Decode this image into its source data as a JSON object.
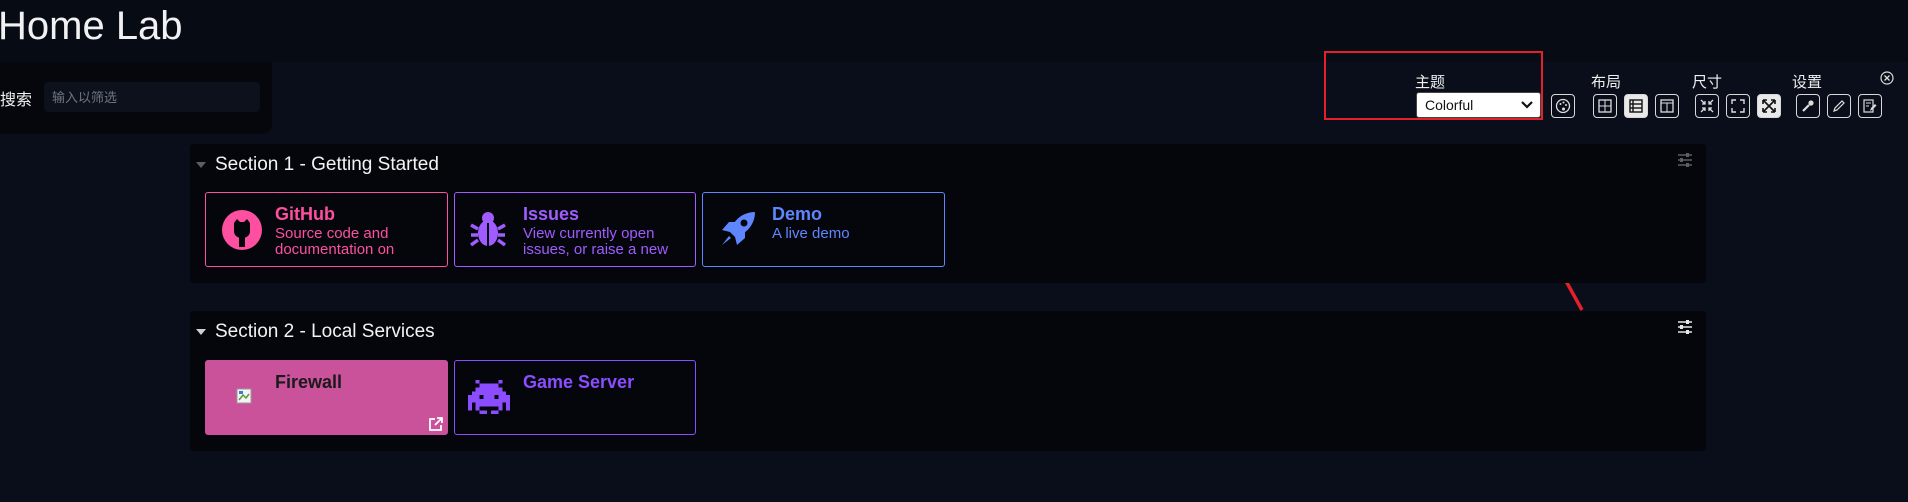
{
  "app": {
    "title": "Home Lab"
  },
  "search": {
    "label": "搜索",
    "placeholder": "输入以筛选"
  },
  "settings": {
    "theme_label": "主题",
    "theme_value": "Colorful",
    "layout_label": "布局",
    "size_label": "尺寸",
    "config_label": "设置"
  },
  "sections": [
    {
      "title": "Section 1 - Getting Started",
      "items": [
        {
          "title": "GitHub",
          "description": "Source code and documentation on",
          "color": "#ff4fa0",
          "icon": "github-icon"
        },
        {
          "title": "Issues",
          "description": "View currently open issues, or raise a new",
          "color": "#a05cff",
          "icon": "bug-icon"
        },
        {
          "title": "Demo",
          "description": "A live demo",
          "color": "#5f86ff",
          "icon": "rocket-icon"
        }
      ]
    },
    {
      "title": "Section 2 - Local Services",
      "items": [
        {
          "title": "Firewall",
          "color": "#c9529a",
          "icon": "broken-image-icon"
        },
        {
          "title": "Game Server",
          "color": "#8b4dff",
          "icon": "space-invader-icon"
        }
      ]
    }
  ],
  "colors": {
    "background": "#070b13",
    "section_bg": "#04060b",
    "annotation": "#e4202a"
  }
}
